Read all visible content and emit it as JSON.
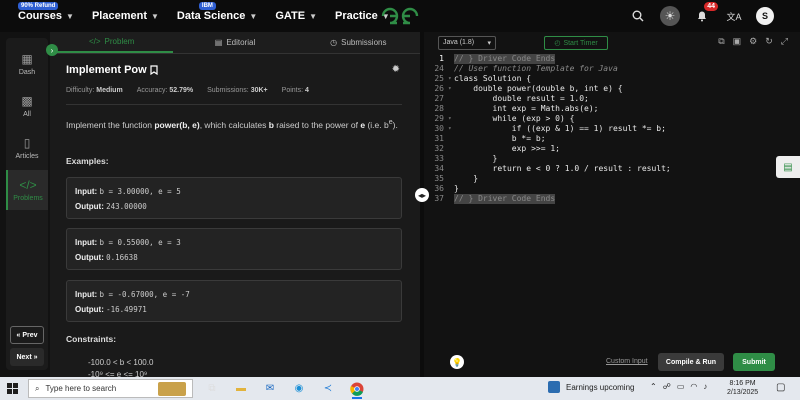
{
  "topnav": {
    "items": [
      {
        "label": "Courses",
        "badge": "90% Refund"
      },
      {
        "label": "Placement",
        "badge": ""
      },
      {
        "label": "Data Science",
        "badge": "IBM"
      },
      {
        "label": "GATE",
        "badge": ""
      },
      {
        "label": "Practice",
        "badge": ""
      }
    ],
    "notification_count": "44",
    "avatar_letter": "S",
    "logo": "GfG"
  },
  "sidebar": {
    "items": [
      {
        "label": "Dash",
        "icon": "grid-icon"
      },
      {
        "label": "All",
        "icon": "squares-icon"
      },
      {
        "label": "Articles",
        "icon": "book-icon"
      },
      {
        "label": "Problems",
        "icon": "code-icon",
        "active": true
      }
    ],
    "prev_label": "« Prev",
    "next_label": "Next »"
  },
  "problem_tabs": [
    {
      "label": "Problem",
      "icon": "</>"
    },
    {
      "label": "Editorial",
      "icon": "▤"
    },
    {
      "label": "Submissions",
      "icon": "◷"
    }
  ],
  "problem": {
    "title": "Implement Pow",
    "difficulty_label": "Difficulty:",
    "difficulty": "Medium",
    "accuracy_label": "Accuracy:",
    "accuracy": "52.79%",
    "submissions_label": "Submissions:",
    "submissions": "30K+",
    "points_label": "Points:",
    "points": "4",
    "desc_1": "Implement the function ",
    "desc_fn": "power(b, e)",
    "desc_2": ", which calculates ",
    "desc_b": "b",
    "desc_3": " raised to the power of ",
    "desc_e": "e",
    "desc_4": " (i.e. b",
    "desc_sup": "e",
    "desc_5": ").",
    "examples_heading": "Examples:",
    "examples": [
      {
        "input": "b = 3.00000, e = 5",
        "output": "243.00000"
      },
      {
        "input": "b = 0.55000, e = 3",
        "output": "0.16638"
      },
      {
        "input": "b = -0.67000, e = -7",
        "output": "-16.49971"
      }
    ],
    "input_label": "Input:",
    "output_label": "Output:",
    "constraints_heading": "Constraints:",
    "constraint_1": "-100.0 < b < 100.0",
    "constraint_2": "-10⁹ <= e <= 10⁹"
  },
  "editor": {
    "language": "Java (1.8)",
    "timer_label": "Start Timer",
    "lines": [
      {
        "n": "1",
        "text": "// } Driver Code Ends",
        "style": "hl"
      },
      {
        "n": "24",
        "text": "// User function Template for Java",
        "style": "comment"
      },
      {
        "n": "25",
        "text": "class Solution {",
        "style": ""
      },
      {
        "n": "26",
        "text": "    double power(double b, int e) {",
        "style": ""
      },
      {
        "n": "27",
        "text": "        double result = 1.0;",
        "style": ""
      },
      {
        "n": "28",
        "text": "        int exp = Math.abs(e);",
        "style": ""
      },
      {
        "n": "29",
        "text": "        while (exp > 0) {",
        "style": ""
      },
      {
        "n": "30",
        "text": "            if ((exp & 1) == 1) result *= b;",
        "style": ""
      },
      {
        "n": "31",
        "text": "            b *= b;",
        "style": ""
      },
      {
        "n": "32",
        "text": "            exp >>= 1;",
        "style": ""
      },
      {
        "n": "33",
        "text": "        }",
        "style": ""
      },
      {
        "n": "34",
        "text": "        return e < 0 ? 1.0 / result : result;",
        "style": ""
      },
      {
        "n": "35",
        "text": "    }",
        "style": ""
      },
      {
        "n": "36",
        "text": "}",
        "style": ""
      },
      {
        "n": "37",
        "text": "// } Driver Code Ends",
        "style": "hl"
      }
    ],
    "custom_input_label": "Custom Input",
    "run_label": "Compile & Run",
    "submit_label": "Submit"
  },
  "taskbar": {
    "search_placeholder": "Type here to search",
    "news": "Earnings upcoming",
    "time": "8:16 PM",
    "date": "2/13/2025"
  }
}
